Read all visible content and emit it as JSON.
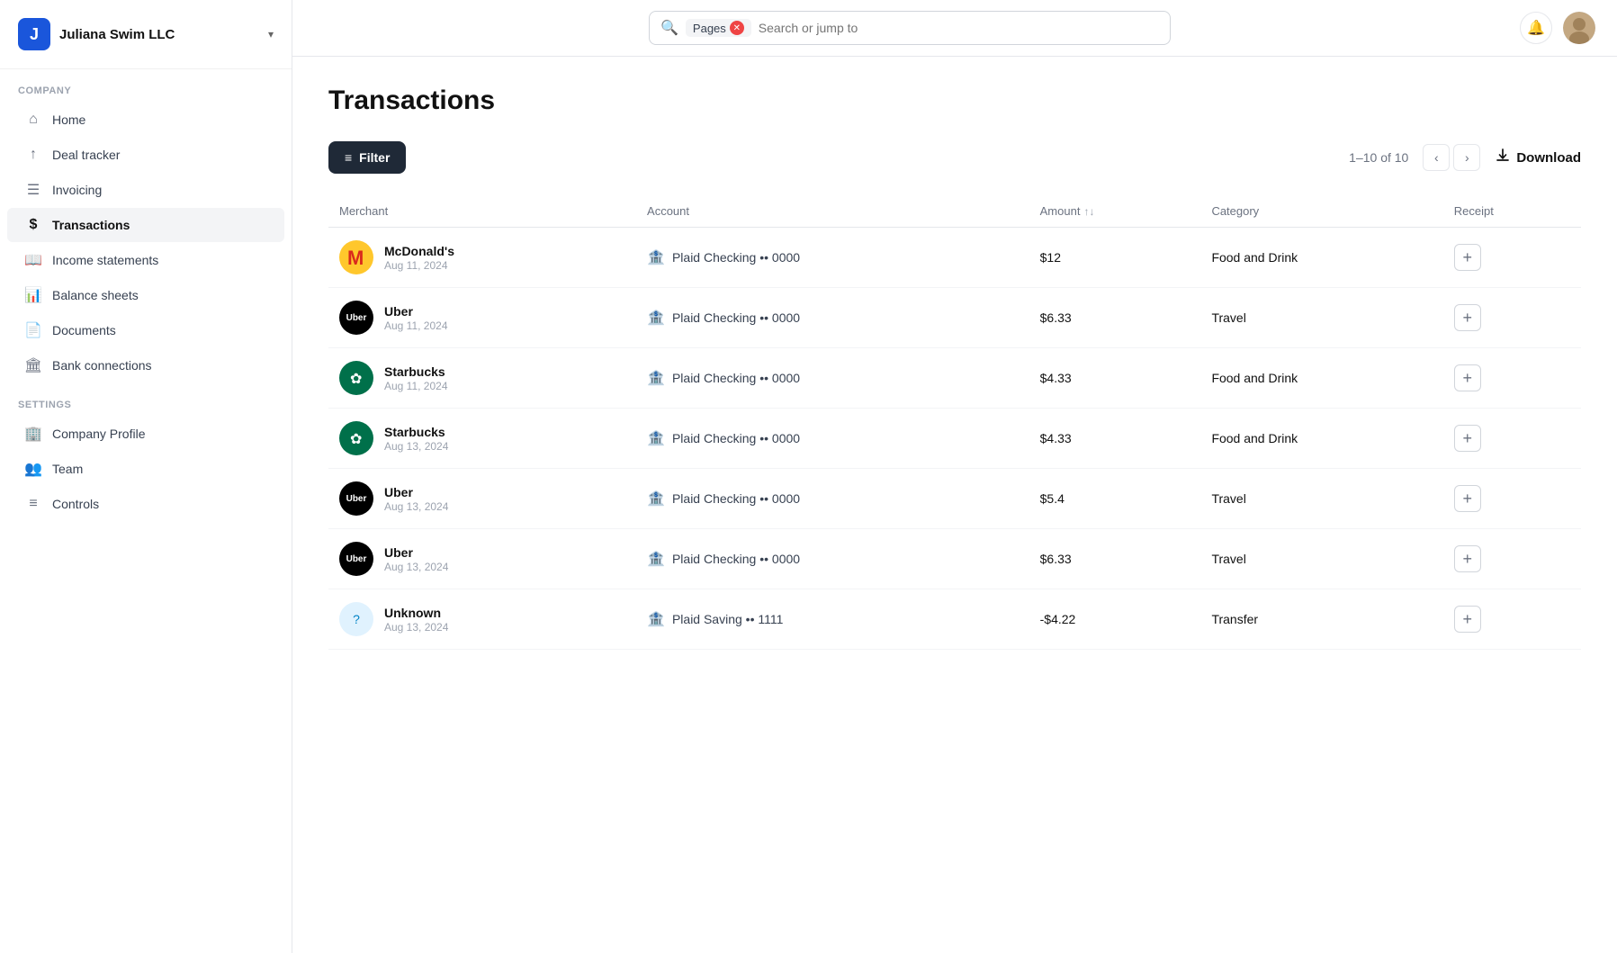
{
  "company": {
    "logo_letter": "J",
    "name": "Juliana Swim LLC",
    "dropdown_icon": "▾"
  },
  "topbar": {
    "search_tag": "Pages",
    "search_placeholder": "Search or jump to",
    "notification_icon": "🔔"
  },
  "sidebar": {
    "sections": [
      {
        "label": "Company",
        "items": [
          {
            "id": "home",
            "icon": "⌂",
            "label": "Home",
            "active": false
          },
          {
            "id": "deal-tracker",
            "icon": "S↑",
            "label": "Deal tracker",
            "active": false
          },
          {
            "id": "invoicing",
            "icon": "☰",
            "label": "Invoicing",
            "active": false
          },
          {
            "id": "transactions",
            "icon": "$",
            "label": "Transactions",
            "active": true
          },
          {
            "id": "income-statements",
            "icon": "📖",
            "label": "Income statements",
            "active": false
          },
          {
            "id": "balance-sheets",
            "icon": "📊",
            "label": "Balance sheets",
            "active": false
          },
          {
            "id": "documents",
            "icon": "📄",
            "label": "Documents",
            "active": false
          },
          {
            "id": "bank-connections",
            "icon": "🏛",
            "label": "Bank connections",
            "active": false
          }
        ]
      },
      {
        "label": "Settings",
        "items": [
          {
            "id": "company-profile",
            "icon": "🏢",
            "label": "Company Profile",
            "active": false
          },
          {
            "id": "team",
            "icon": "👥",
            "label": "Team",
            "active": false
          },
          {
            "id": "controls",
            "icon": "≡",
            "label": "Controls",
            "active": false
          }
        ]
      }
    ]
  },
  "page": {
    "title": "Transactions"
  },
  "toolbar": {
    "filter_label": "Filter",
    "pagination": "1–10 of 10",
    "download_label": "Download"
  },
  "table": {
    "columns": [
      "Merchant",
      "Account",
      "Amount",
      "Category",
      "Receipt"
    ],
    "rows": [
      {
        "merchant": "McDonald's",
        "merchant_logo_type": "mcdonalds",
        "merchant_logo_emoji": "M",
        "date": "Aug 11, 2024",
        "account": "Plaid Checking •• 0000",
        "amount": "$12",
        "amount_type": "positive",
        "category": "Food and Drink"
      },
      {
        "merchant": "Uber",
        "merchant_logo_type": "uber",
        "merchant_logo_emoji": "Uber",
        "date": "Aug 11, 2024",
        "account": "Plaid Checking •• 0000",
        "amount": "$6.33",
        "amount_type": "positive",
        "category": "Travel"
      },
      {
        "merchant": "Starbucks",
        "merchant_logo_type": "starbucks",
        "merchant_logo_emoji": "✿",
        "date": "Aug 11, 2024",
        "account": "Plaid Checking •• 0000",
        "amount": "$4.33",
        "amount_type": "positive",
        "category": "Food and Drink"
      },
      {
        "merchant": "Starbucks",
        "merchant_logo_type": "starbucks",
        "merchant_logo_emoji": "✿",
        "date": "Aug 13, 2024",
        "account": "Plaid Checking •• 0000",
        "amount": "$4.33",
        "amount_type": "positive",
        "category": "Food and Drink"
      },
      {
        "merchant": "Uber",
        "merchant_logo_type": "uber",
        "merchant_logo_emoji": "Uber",
        "date": "Aug 13, 2024",
        "account": "Plaid Checking •• 0000",
        "amount": "$5.4",
        "amount_type": "positive",
        "category": "Travel"
      },
      {
        "merchant": "Uber",
        "merchant_logo_type": "uber",
        "merchant_logo_emoji": "Uber",
        "date": "Aug 13, 2024",
        "account": "Plaid Checking •• 0000",
        "amount": "$6.33",
        "amount_type": "positive",
        "category": "Travel"
      },
      {
        "merchant": "Unknown",
        "merchant_logo_type": "unknown",
        "merchant_logo_emoji": "?",
        "date": "Aug 13, 2024",
        "account": "Plaid Saving •• 1111",
        "amount": "-$4.22",
        "amount_type": "negative",
        "category": "Transfer"
      }
    ]
  }
}
